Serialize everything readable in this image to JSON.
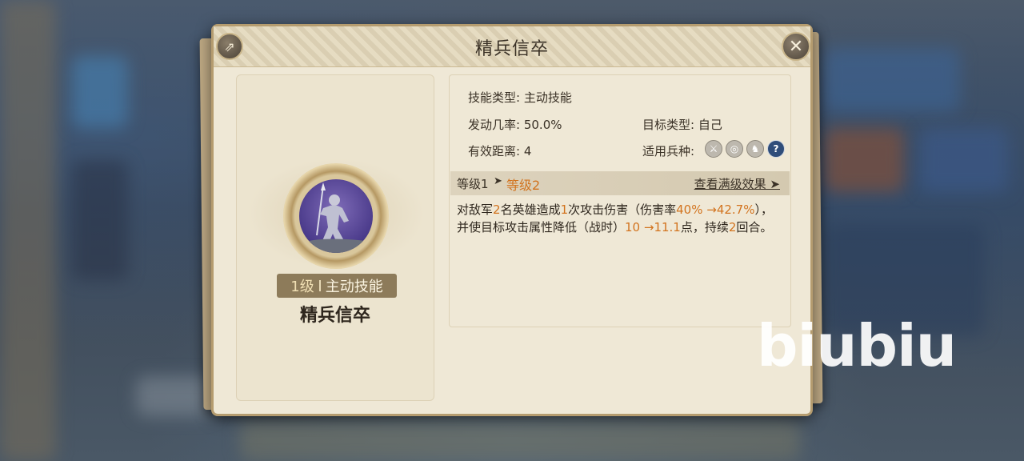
{
  "panel": {
    "title": "精兵信卒"
  },
  "skill": {
    "level": "1级",
    "type": "主动技能",
    "name": "精兵信卒"
  },
  "info": {
    "skill_type_label": "技能类型:",
    "skill_type_value": "主动技能",
    "chance_label": "发动几率:",
    "chance_value": "50.0%",
    "target_label": "目标类型:",
    "target_value": "自己",
    "range_label": "有效距离:",
    "range_value": "4",
    "units_label": "适用兵种:",
    "unit_icons": [
      "sword-icon",
      "target-icon",
      "horse-icon",
      "help-icon"
    ]
  },
  "level_bar": {
    "from": "等级1",
    "arrow": "➤",
    "to": "等级2",
    "full_link": "查看满级效果 ➤"
  },
  "description": {
    "p1": "对敌军",
    "n1": "2",
    "p2": "名英雄造成",
    "n2": "1",
    "p3": "次攻击伤害（伤害率",
    "n3": "40% →42.7%",
    "p4": "），并使目标攻击属性降低（战时）",
    "n4": "10 →11.1",
    "p5": "点，持续",
    "n5": "2",
    "p6": "回合。"
  },
  "watermark": "biubiu",
  "colors": {
    "highlight": "#d2731e",
    "panel_bg": "#efe8d6"
  }
}
